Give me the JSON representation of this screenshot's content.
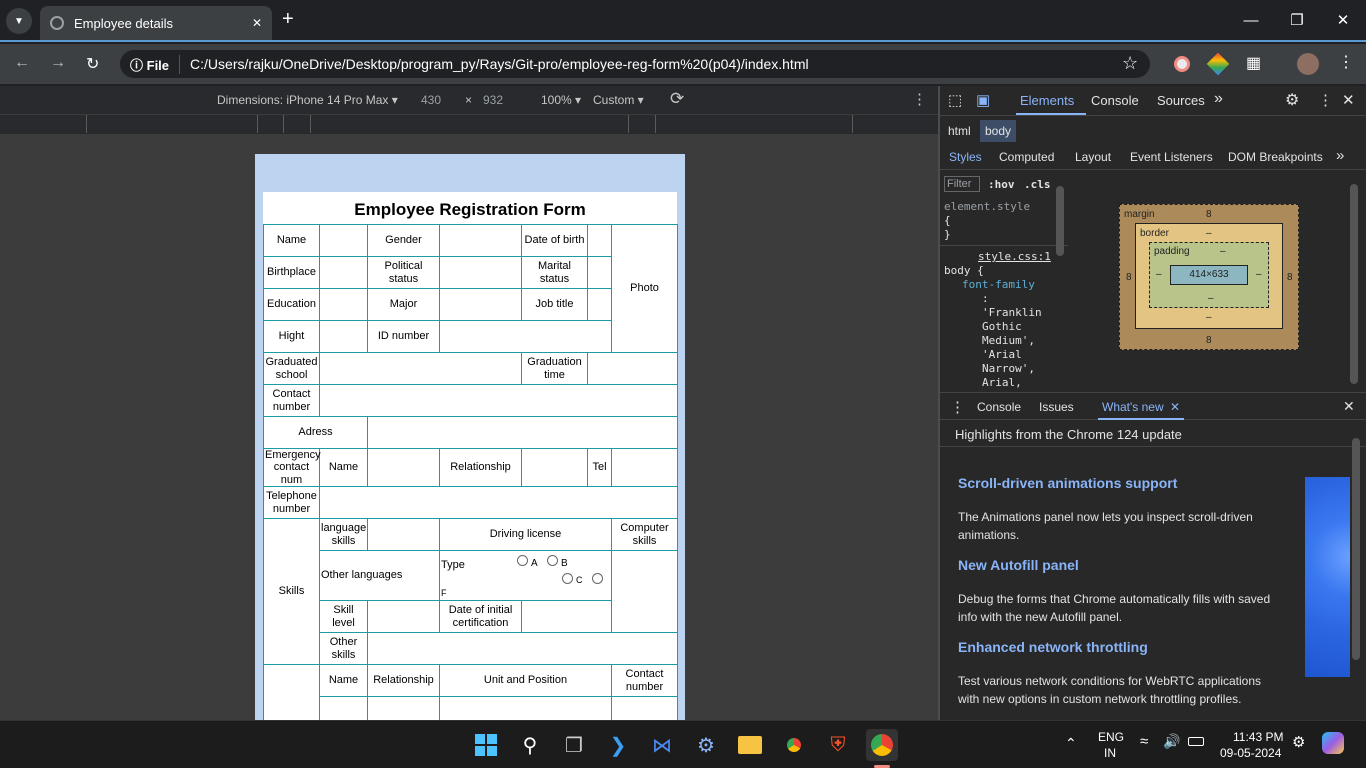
{
  "browser": {
    "tab_title": "Employee details",
    "tab_close": "✕",
    "new_tab": "+",
    "chip": "File",
    "url": "C:/Users/rajku/OneDrive/Desktop/program_py/Rays/Git-pro/employee-reg-form%20(p04)/index.html"
  },
  "device_toolbar": {
    "dimensions": "Dimensions: iPhone 14 Pro Max ▾",
    "width": "430",
    "times": "×",
    "height": "932",
    "zoom": "100% ▾",
    "throttle": "Custom ▾"
  },
  "form": {
    "title": "Employee Registration Form",
    "name": "Name",
    "gender": "Gender",
    "dob": "Date of birth",
    "photo": "Photo",
    "birthplace": "Birthplace",
    "political": "Political status",
    "marital": "Marital status",
    "education": "Education",
    "major": "Major",
    "job_title": "Job title",
    "hight": "Hight",
    "id_number": "ID number",
    "graduated": "Graduated school",
    "grad_time": "Graduation time",
    "contact": "Contact number",
    "adress": "Adress",
    "emergency": "Emergency contact num",
    "em_name": "Name",
    "relationship": "Relationship",
    "tel": "Tel",
    "telephone": "Telephone number",
    "skills": "Skills",
    "language": "language skills",
    "driving": "Driving license",
    "computer": "Computer skills",
    "other_lang": "Other languages",
    "type": "Type",
    "opt_a": "A",
    "opt_b": "B",
    "opt_c": "C",
    "opt_f": "F",
    "skill_level": "Skill level",
    "initial_cert": "Date of initial certification",
    "other_skills": "Other skills",
    "fam_name": "Name",
    "fam_rel": "Relationship",
    "unit_pos": "Unit and Position",
    "fam_contact": "Contact number"
  },
  "devtools": {
    "tabs": [
      "Elements",
      "Console",
      "Sources",
      "»"
    ],
    "crumb_html": "html",
    "crumb_body": "body",
    "subtabs": [
      "Styles",
      "Computed",
      "Layout",
      "Event Listeners",
      "DOM Breakpoints",
      "»"
    ],
    "filter": "Filter",
    "hov": ":hov",
    "cls": ".cls",
    "element_style": "element.style",
    "brace_open": "{",
    "brace_close": "}",
    "source": "style.css:1",
    "selector": "body {",
    "property": "font-family",
    "colon": ":",
    "value_lines": [
      "'Franklin",
      "Gothic",
      "Medium',",
      "'Arial",
      "Narrow',",
      "Arial,"
    ],
    "bm_margin": "margin",
    "bm_border": "border",
    "bm_padding": "padding",
    "bm_content": "414×633",
    "bm_8": "8",
    "bm_dash": "–",
    "drawer_tabs": [
      "Console",
      "Issues",
      "What's new"
    ],
    "wn_header": "Highlights from the Chrome 124 update",
    "wn_items": [
      {
        "title": "Scroll-driven animations support",
        "text": "The Animations panel now lets you inspect scroll-driven animations."
      },
      {
        "title": "New Autofill panel",
        "text": "Debug the forms that Chrome automatically fills with saved info with the new Autofill panel."
      },
      {
        "title": "Enhanced network throttling",
        "text": "Test various network conditions for WebRTC applications with new options in custom network throttling profiles."
      }
    ]
  },
  "taskbar": {
    "lang1": "ENG",
    "lang2": "IN",
    "time": "11:43 PM",
    "date": "09-05-2024"
  },
  "colors": {
    "accent": "#8ab4f8",
    "table_border": "#1a9ba8",
    "phone_bg": "#bcd4f0"
  }
}
